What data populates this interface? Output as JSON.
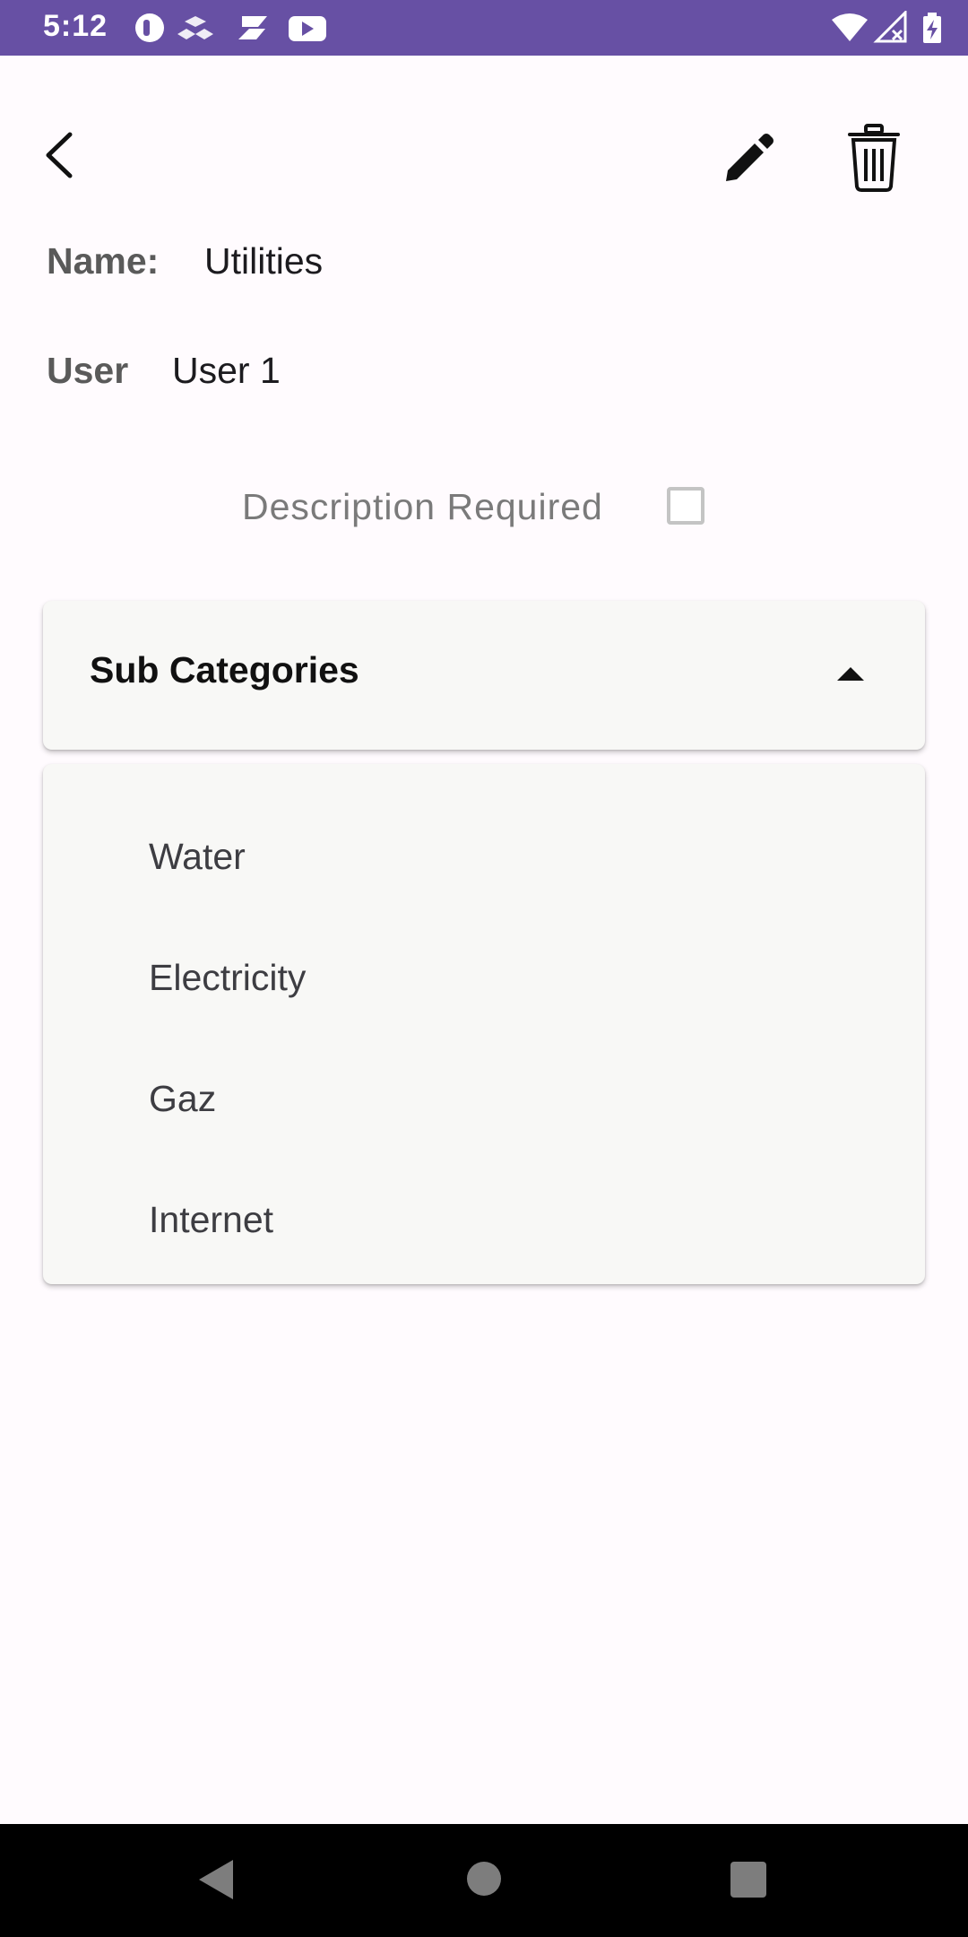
{
  "status_bar": {
    "time": "5:12",
    "background": "#6750a4",
    "left_icons": [
      "pill-icon",
      "cube-icon",
      "stack-icon",
      "youtube-icon"
    ],
    "right_icons": [
      "wifi-icon",
      "signal-off-icon",
      "battery-charging-icon"
    ]
  },
  "app_bar": {
    "back_icon": "chevron-left-icon",
    "edit_icon": "pencil-icon",
    "delete_icon": "trash-icon"
  },
  "details": {
    "name_label": "Name:",
    "name_value": "Utilities",
    "user_label": "User",
    "user_value": "User 1",
    "description_required_label": "Description Required",
    "description_required_checked": false
  },
  "sub_categories": {
    "title": "Sub Categories",
    "expanded": true,
    "items": [
      "Water",
      "Electricity",
      "Gaz",
      "Internet"
    ]
  },
  "nav_bar": {
    "buttons": [
      "nav-back-icon",
      "nav-home-icon",
      "nav-recents-icon"
    ]
  }
}
